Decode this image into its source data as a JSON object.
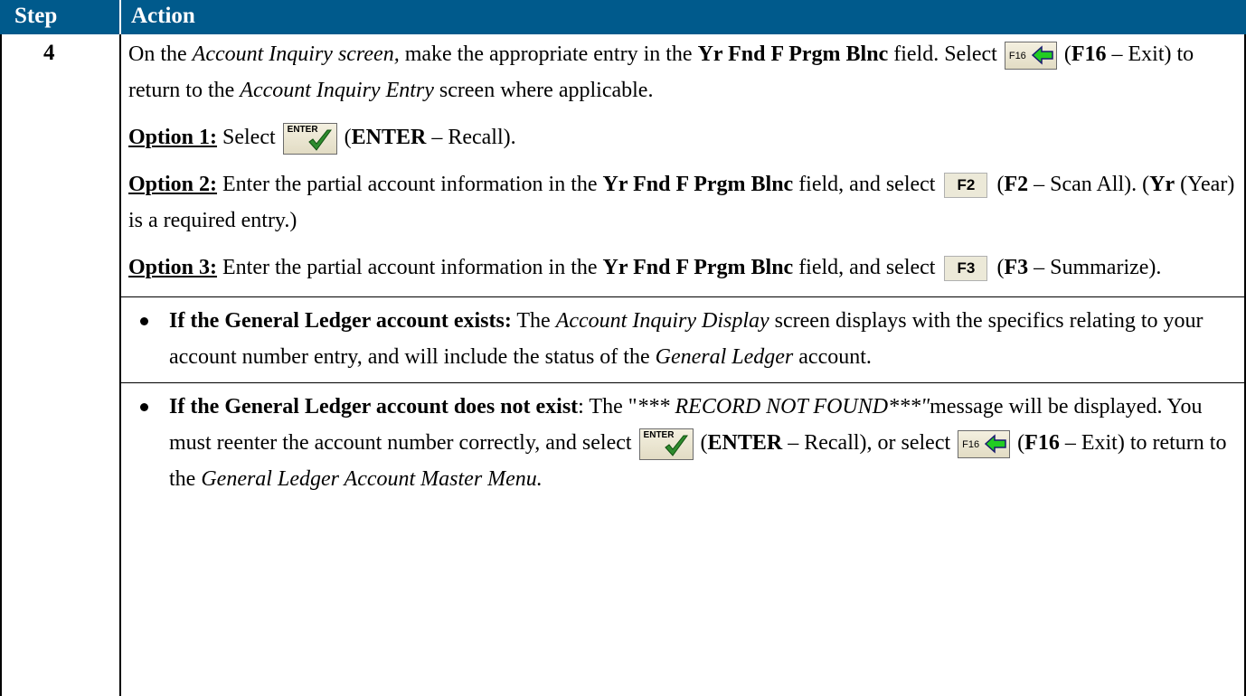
{
  "header": {
    "step_label": "Step",
    "action_label": "Action"
  },
  "step_number": "4",
  "para1": {
    "t1": "On the ",
    "t2": "Account Inquiry screen,",
    "t3": " make the appropriate entry in the ",
    "t4": "Yr Fnd F Prgm Blnc",
    "t5": " field.  Select ",
    "t6": " (",
    "t7": "F16",
    "t8": " – Exit) to return to the ",
    "t9": "Account Inquiry Entry",
    "t10": " screen where applicable."
  },
  "option1": {
    "label": "Option 1:",
    "t1": "  Select ",
    "t2": " (",
    "t3": "ENTER",
    "t4": " – Recall)."
  },
  "option2": {
    "label": "Option 2:",
    "t1": "  Enter the partial account information in the ",
    "t2": "Yr Fnd F Prgm Blnc",
    "t3": " field, and select ",
    "t4": " (",
    "t5": "F2",
    "t6": " – Scan All).  (",
    "t7": "Yr",
    "t8": " (Year) is a required entry.)"
  },
  "option3": {
    "label": "Option 3:",
    "t1": "  Enter the partial account information in the ",
    "t2": "Yr Fnd F Prgm Blnc",
    "t3": " field, and select ",
    "t4": " (",
    "t5": "F3",
    "t6": " – Summarize)."
  },
  "bullet1": {
    "t1": "If the General Ledger account exists:",
    "t2": "  The ",
    "t3": "Account Inquiry Display",
    "t4": " screen displays with the specifics relating to your account number entry, and will include the status of the ",
    "t5": "General Ledger",
    "t6": " account."
  },
  "bullet2": {
    "t1": "If the General Ledger account does not exist",
    "t2": ":  The \"",
    "t3": "*** RECORD NOT FOUND***\"",
    "t4": "message will be displayed.  You must reenter the account number correctly, and select ",
    "t5": " (",
    "t6": "ENTER",
    "t7": " – Recall), or select ",
    "t8": " (",
    "t9": "F16",
    "t10": " – Exit) to return to the ",
    "t11": "General Ledger Account Master Menu."
  },
  "icons": {
    "f16": {
      "name": "exit-arrow-icon",
      "label": "F16"
    },
    "enter": {
      "name": "enter-check-icon",
      "label": "ENTER"
    },
    "f2": {
      "name": "f2-key-icon",
      "label": "F2"
    },
    "f3": {
      "name": "f3-key-icon",
      "label": "F3"
    }
  },
  "colors": {
    "header_bg": "#005a8c",
    "header_text": "#ffffff",
    "arrow": "#22cc22",
    "check": "#2e8b2e"
  }
}
